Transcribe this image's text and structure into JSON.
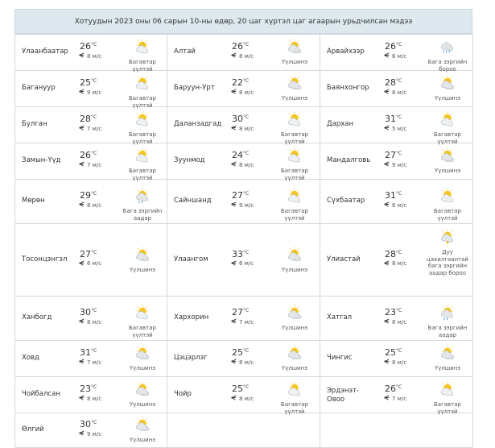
{
  "forecast": {
    "title": "Хотуудын 2023 оны 06 сарын 10-ны өдөр, 20 цаг хүртэл цаг агаарын урьдчилсан мэдээ",
    "unit": "°C",
    "rows": [
      [
        {
          "city": "Улаанбаатар",
          "temp": "26",
          "wind": "8 м/с",
          "weather": "Багавтар үүлтэй",
          "icon": "partly-cloudy-icon"
        },
        {
          "city": "Алтай",
          "temp": "26",
          "wind": "8 м/с",
          "weather": "Үүлшинэ",
          "icon": "cloudy-icon"
        },
        {
          "city": "Арвайхээр",
          "temp": "26",
          "wind": "6 м/с",
          "weather": "Бага зэргийн бороо",
          "icon": "rain-icon"
        }
      ],
      [
        {
          "city": "Баганууp",
          "temp": "25",
          "wind": "9 м/с",
          "weather": "Багавтар үүлтэй",
          "icon": "partly-cloudy-icon"
        },
        {
          "city": "Баруун-Урт",
          "temp": "22",
          "wind": "8 м/с",
          "weather": "Үүлшинэ",
          "icon": "cloudy-icon"
        },
        {
          "city": "Баянхонгор",
          "temp": "28",
          "wind": "8 м/с",
          "weather": "Үүлшинэ",
          "icon": "cloudy-icon"
        }
      ],
      [
        {
          "city": "Булган",
          "temp": "28",
          "wind": "7 м/с",
          "weather": "Багавтар үүлтэй",
          "icon": "partly-cloudy-icon"
        },
        {
          "city": "Даланзадгад",
          "temp": "30",
          "wind": "8 м/с",
          "weather": "Багавтар үүлтэй",
          "icon": "partly-cloudy-icon"
        },
        {
          "city": "Дархан",
          "temp": "31",
          "wind": "5 м/с",
          "weather": "Багавтар үүлтэй",
          "icon": "partly-cloudy-icon"
        }
      ],
      [
        {
          "city": "Замын-Үүд",
          "temp": "26",
          "wind": "7 м/с",
          "weather": "Багавтар үүлтэй",
          "icon": "partly-cloudy-icon"
        },
        {
          "city": "Зуунмод",
          "temp": "24",
          "wind": "8 м/с",
          "weather": "Багавтар үүлтэй",
          "icon": "partly-cloudy-icon"
        },
        {
          "city": "Мандалговь",
          "temp": "27",
          "wind": "9 м/с",
          "weather": "Үүлшинэ",
          "icon": "cloudy-icon"
        }
      ],
      [
        {
          "city": "Мөрөн",
          "temp": "29",
          "wind": "8 м/с",
          "weather": "Бага зэргийн аадар",
          "icon": "shower-icon"
        },
        {
          "city": "Сайншанд",
          "temp": "27",
          "wind": "9 м/с",
          "weather": "Багавтар үүлтэй",
          "icon": "partly-cloudy-icon"
        },
        {
          "city": "Сүхбаатар",
          "temp": "31",
          "wind": "6 м/с",
          "weather": "Багавтар үүлтэй",
          "icon": "partly-cloudy-icon"
        }
      ],
      [
        {
          "city": "Тосонцэнгэл",
          "temp": "27",
          "wind": "6 м/с",
          "weather": "Үүлшинэ",
          "icon": "cloudy-icon"
        },
        {
          "city": "Улаангом",
          "temp": "33",
          "wind": "6 м/с",
          "weather": "Үүлшинэ",
          "icon": "cloudy-icon"
        },
        {
          "city": "Улиастай",
          "temp": "28",
          "wind": "8 м/с",
          "weather": "Дуу цахилгаантай бага зэргийн аадар бороо",
          "icon": "thunder-icon"
        }
      ],
      [
        {
          "city": "Ханбогд",
          "temp": "30",
          "wind": "8 м/с",
          "weather": "Багавтар үүлтэй",
          "icon": "partly-cloudy-icon"
        },
        {
          "city": "Хархорин",
          "temp": "27",
          "wind": "7 м/с",
          "weather": "Үүлшинэ",
          "icon": "cloudy-icon"
        },
        {
          "city": "Хатгал",
          "temp": "23",
          "wind": "8 м/с",
          "weather": "Бага зэргийн аадар",
          "icon": "shower-icon"
        }
      ],
      [
        {
          "city": "Ховд",
          "temp": "31",
          "wind": "7 м/с",
          "weather": "Үүлшинэ",
          "icon": "cloudy-icon"
        },
        {
          "city": "Цэцэрлэг",
          "temp": "25",
          "wind": "8 м/с",
          "weather": "Үүлшинэ",
          "icon": "cloudy-icon"
        },
        {
          "city": "Чингис",
          "temp": "25",
          "wind": "8 м/с",
          "weather": "Үүлшинэ",
          "icon": "cloudy-icon"
        }
      ],
      [
        {
          "city": "Чойбалсан",
          "temp": "23",
          "wind": "8 м/с",
          "weather": "Үүлшинэ",
          "icon": "cloudy-icon"
        },
        {
          "city": "Чойр",
          "temp": "25",
          "wind": "8 м/с",
          "weather": "Багавтар үүлтэй",
          "icon": "partly-cloudy-icon"
        },
        {
          "city": "Эрдэнэт-Овоо",
          "temp": "26",
          "wind": "7 м/с",
          "weather": "Багавтар үүлтэй",
          "icon": "partly-cloudy-icon"
        }
      ],
      [
        {
          "city": "Өлгий",
          "temp": "30",
          "wind": "9 м/с",
          "weather": "Үүлшинэ",
          "icon": "cloudy-icon"
        },
        null,
        null
      ]
    ]
  }
}
